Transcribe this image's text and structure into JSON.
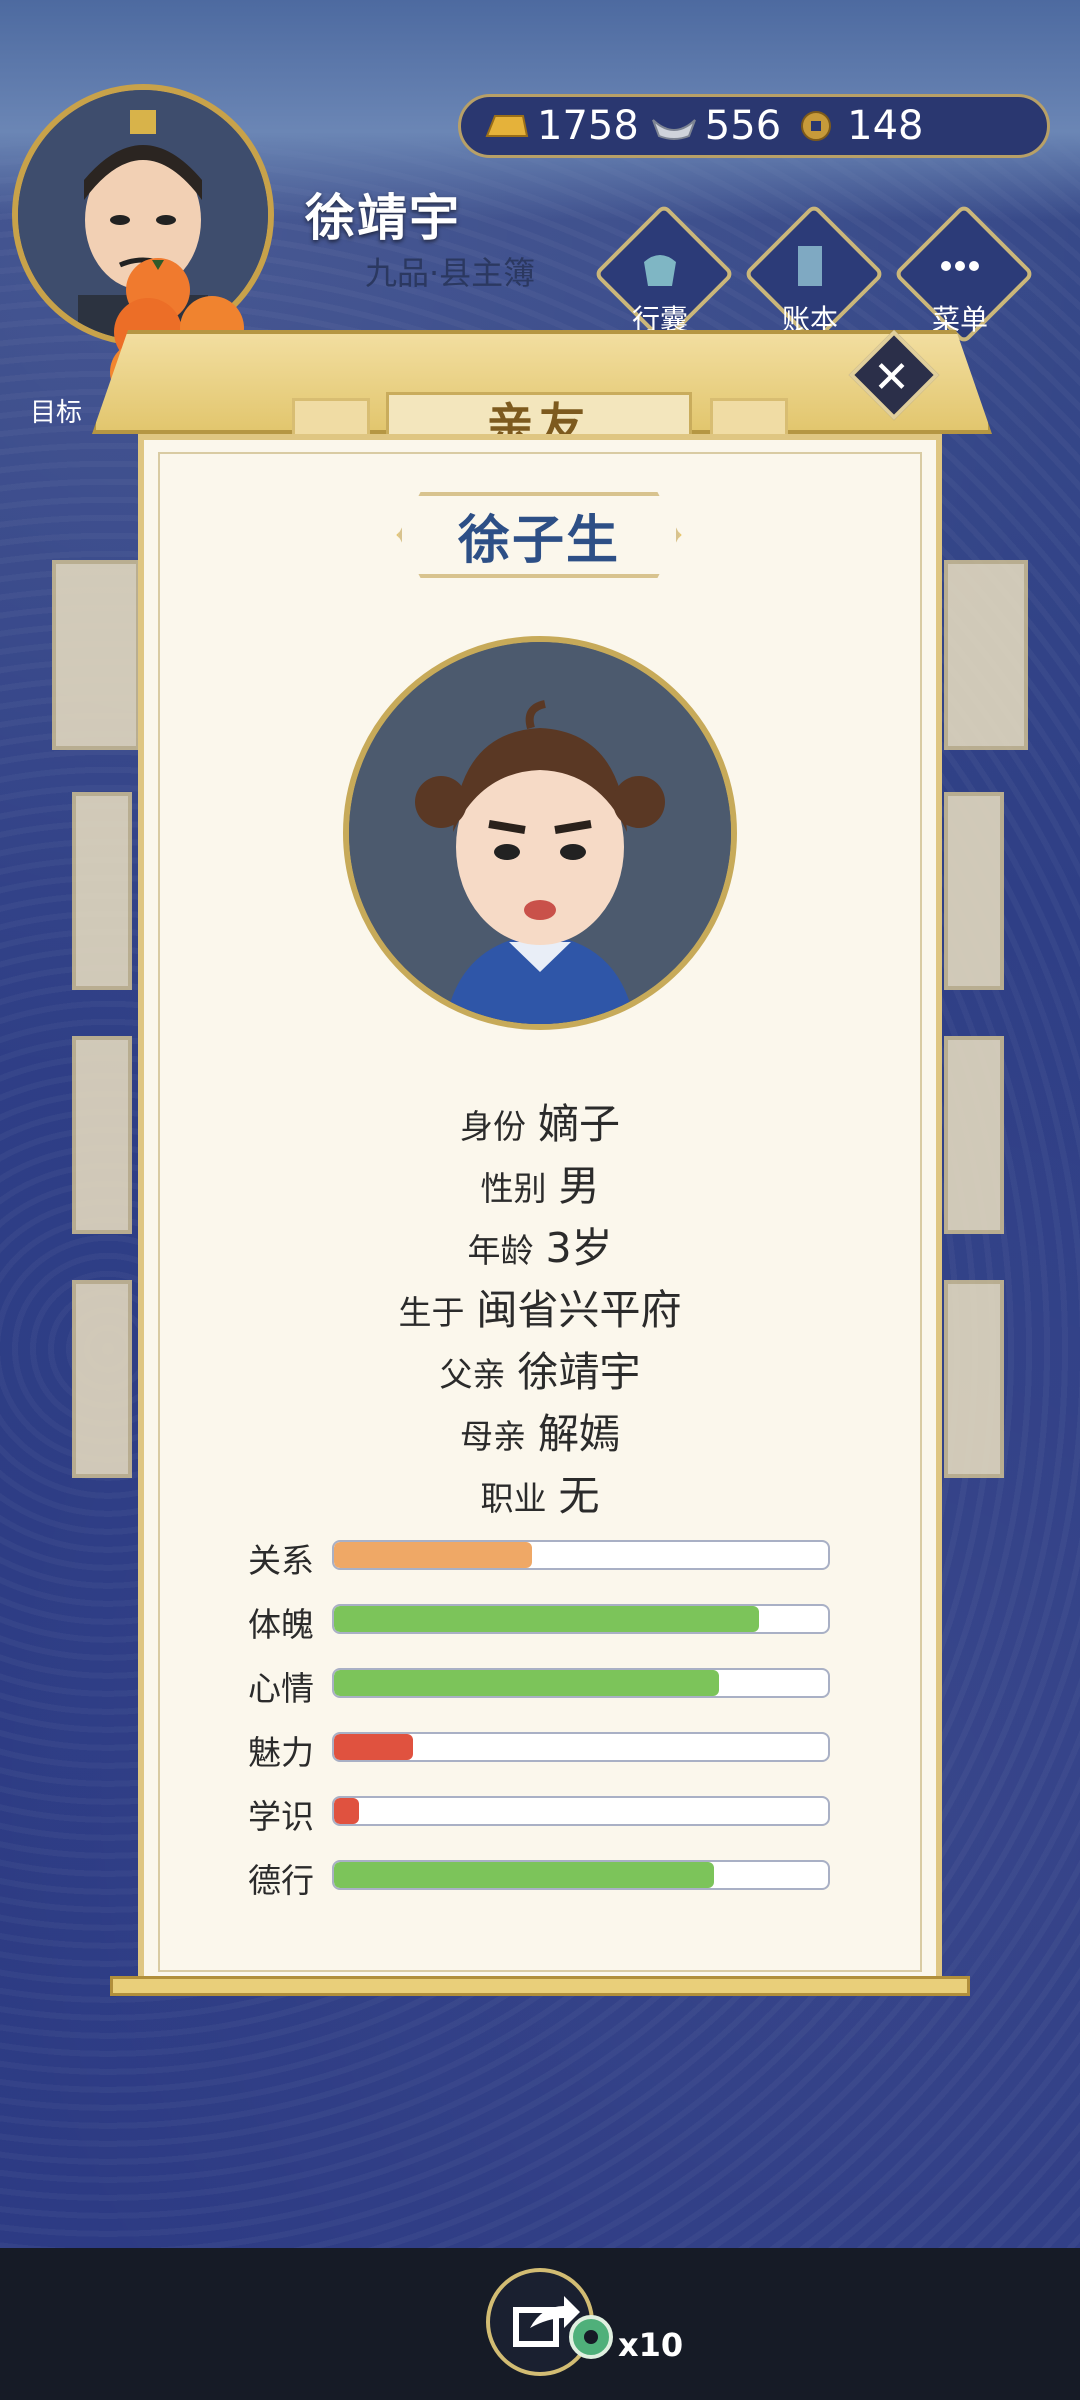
{
  "player": {
    "name": "徐靖宇",
    "rank": "九品·县主簿"
  },
  "resources": {
    "gold": "1758",
    "silver": "556",
    "coins": "148",
    "gold_icon": "gold-ingot-icon",
    "silver_icon": "silver-ingot-icon",
    "coin_icon": "copper-coin-icon"
  },
  "hud_buttons": [
    {
      "label": "行囊",
      "icon": "bag-icon"
    },
    {
      "label": "账本",
      "icon": "ledger-icon"
    },
    {
      "label": "菜单",
      "icon": "menu-dots-icon"
    }
  ],
  "goal_label": "目标",
  "modal": {
    "title": "亲友",
    "close": "✕",
    "person_name": "徐子生",
    "info": [
      {
        "key": "身份",
        "value": "嫡子"
      },
      {
        "key": "性别",
        "value": "男"
      },
      {
        "key": "年龄",
        "value": "3岁"
      },
      {
        "key": "生于",
        "value": "闽省兴平府"
      },
      {
        "key": "父亲",
        "value": "徐靖宇"
      },
      {
        "key": "母亲",
        "value": "解嫣"
      },
      {
        "key": "职业",
        "value": "无"
      }
    ],
    "stats": [
      {
        "label": "关系",
        "fill": 0.4,
        "color": "#efa866"
      },
      {
        "label": "体魄",
        "fill": 0.86,
        "color": "#7cc45a"
      },
      {
        "label": "心情",
        "fill": 0.78,
        "color": "#7cc45a"
      },
      {
        "label": "魅力",
        "fill": 0.16,
        "color": "#e0523f"
      },
      {
        "label": "学识",
        "fill": 0.05,
        "color": "#e0523f"
      },
      {
        "label": "德行",
        "fill": 0.77,
        "color": "#7cc45a"
      }
    ]
  },
  "share": {
    "icon": "share-icon",
    "count": "x10"
  }
}
